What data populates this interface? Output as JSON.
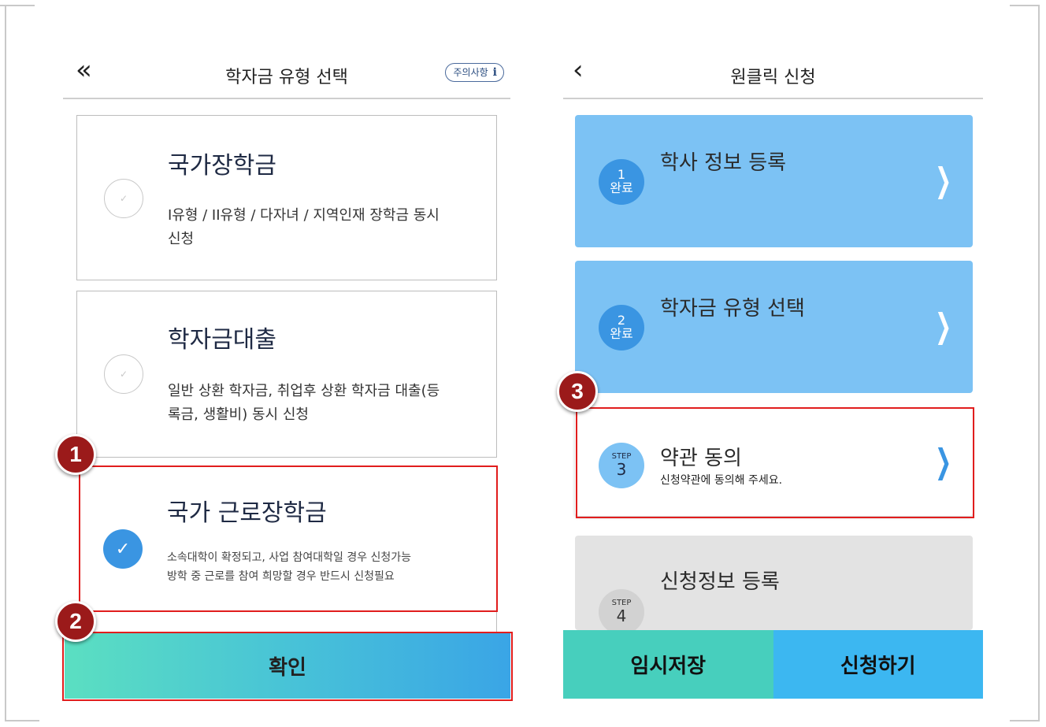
{
  "left_panel": {
    "title": "학자금 유형 선택",
    "back_glyph": "«",
    "notice_button": {
      "label": "주의사항",
      "icon": "i"
    },
    "options": [
      {
        "title": "국가장학금",
        "desc_line1": "I유형 / II유형 / 다자녀 / 지역인재 장학금 동시",
        "desc_line2": "신청",
        "checked": false
      },
      {
        "title": "학자금대출",
        "desc_line1": "일반 상환 학자금, 취업후 상환 학자금 대출(등",
        "desc_line2": "록금, 생활비) 동시 신청",
        "checked": false
      },
      {
        "title": "국가 근로장학금",
        "desc_line1": "소속대학이 확정되고, 사업 참여대학일 경우 신청가능",
        "desc_line2": "방학 중 근로를 참여 희망할 경우 반드시 신청필요",
        "checked": true
      }
    ],
    "confirm_label": "확인"
  },
  "right_panel": {
    "title": "원클릭 신청",
    "back_glyph": "‹",
    "steps": [
      {
        "num": "1",
        "status": "완료",
        "title": "학사 정보 등록",
        "subtitle": ""
      },
      {
        "num": "2",
        "status": "완료",
        "title": "학자금 유형 선택",
        "subtitle": ""
      },
      {
        "num": "3",
        "status": "STEP",
        "title": "약관 동의",
        "subtitle": "신청약관에 동의해 주세요."
      },
      {
        "num": "4",
        "status": "STEP",
        "title": "신청정보 등록",
        "subtitle": ""
      }
    ],
    "save_label": "임시저장",
    "apply_label": "신청하기"
  },
  "callouts": [
    "1",
    "2",
    "3"
  ],
  "colors": {
    "accent_blue": "#3a95e2",
    "done_card": "#7cc2f4",
    "highlight_red": "#e11d1d",
    "callout_badge": "#9b1a1a"
  }
}
